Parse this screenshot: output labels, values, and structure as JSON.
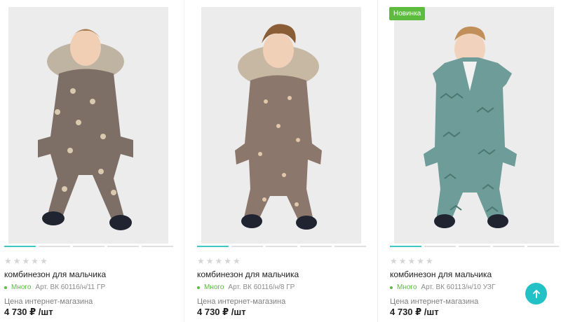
{
  "products": [
    {
      "badge": "",
      "stars": "★★★★★",
      "title": "комбинезон для мальчика",
      "stock": "Много",
      "article": "Арт. ВК 60116/н/11 ГР",
      "price_label": "Цена интернет-магазина",
      "price": "4 730 ₽ /шт"
    },
    {
      "badge": "",
      "stars": "★★★★★",
      "title": "комбинезон для мальчика",
      "stock": "Много",
      "article": "Арт. ВК 60116/н/8 ГР",
      "price_label": "Цена интернет-магазина",
      "price": "4 730 ₽ /шт"
    },
    {
      "badge": "Новинка",
      "stars": "★★★★★",
      "title": "комбинезон для мальчика",
      "stock": "Много",
      "article": "Арт. ВК 60113/н/10 УЗГ",
      "price_label": "Цена интернет-магазина",
      "price": "4 730 ₽ /шт"
    }
  ],
  "colors": {
    "accent": "#21c1c6",
    "stock": "#5dbb3f",
    "badge": "#5dbb3f"
  },
  "icons": {
    "scroll_top": "arrow-up-icon"
  }
}
